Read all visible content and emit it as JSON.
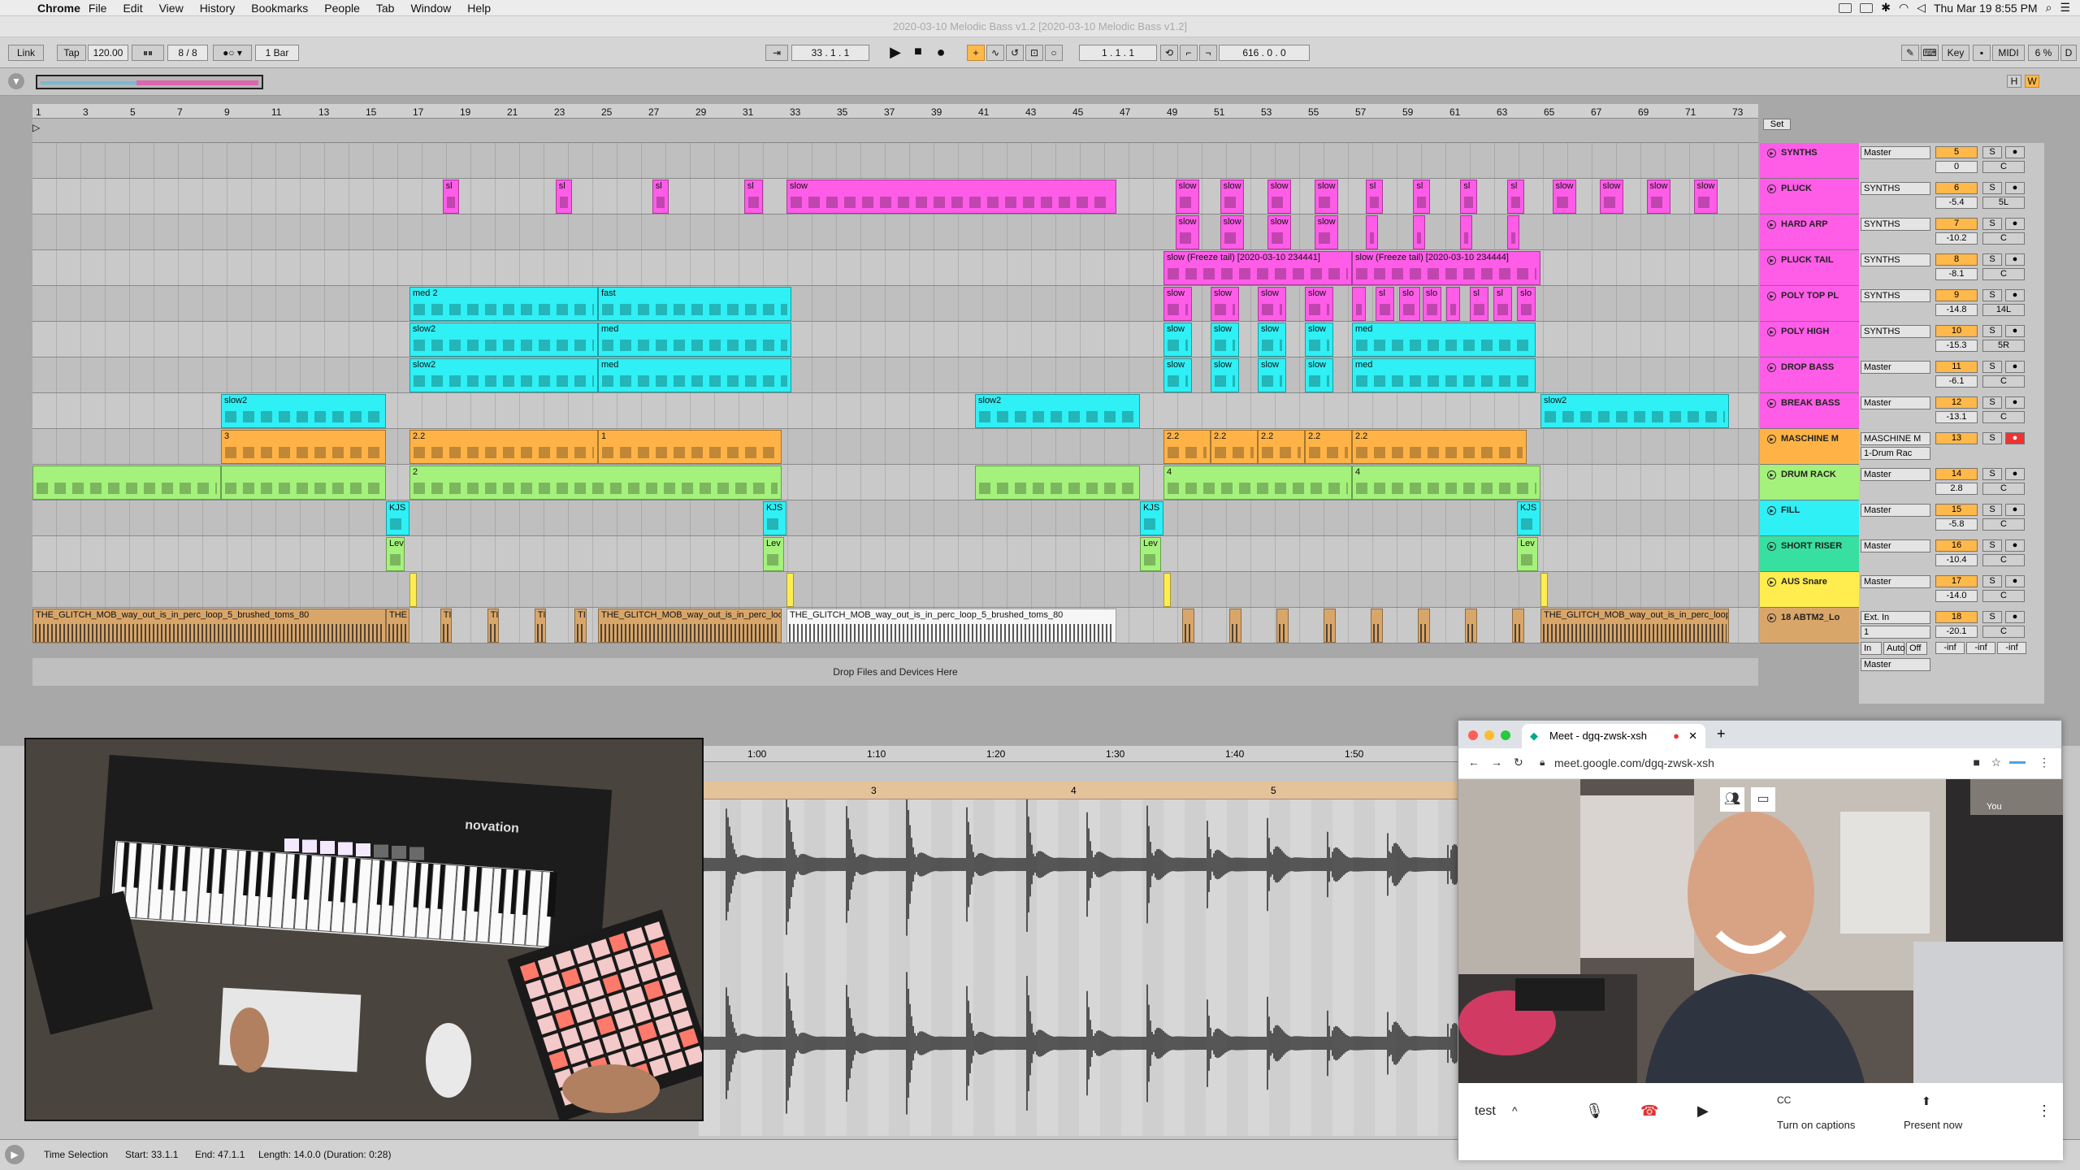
{
  "menubar": {
    "app": "Chrome",
    "items": [
      "File",
      "Edit",
      "View",
      "History",
      "Bookmarks",
      "People",
      "Tab",
      "Window",
      "Help"
    ],
    "clock": "Thu Mar 19  8:55 PM"
  },
  "window": {
    "title": "2020-03-10 Melodic Bass v1.2  [2020-03-10 Melodic Bass v1.2]"
  },
  "transport": {
    "link": "Link",
    "tap": "Tap",
    "bpm": "120.00",
    "sig": "8 / 8",
    "quant": "1 Bar",
    "position": "33 .  1 .  1",
    "loop_start": "1 .  1 .  1",
    "loop_len": "616 .  0 .  0",
    "key": "Key",
    "midi": "MIDI",
    "cpu": "6 %",
    "d": "D",
    "h": "H",
    "w": "W"
  },
  "ruler": {
    "bars": [
      "1",
      "3",
      "5",
      "7",
      "9",
      "11",
      "13",
      "15",
      "17",
      "19",
      "21",
      "23",
      "25",
      "27",
      "29",
      "31",
      "33",
      "35",
      "37",
      "39",
      "41",
      "43",
      "45",
      "47",
      "49",
      "51",
      "53",
      "55",
      "57",
      "59",
      "61",
      "63",
      "65",
      "67",
      "69",
      "71",
      "73"
    ]
  },
  "set_label": "Set",
  "drop_text": "Drop Files and Devices Here",
  "tracks": [
    {
      "name": "SYNTHS",
      "color": "#ff5ce8",
      "route": "Master",
      "num": "5",
      "vol": "0",
      "pan": "C"
    },
    {
      "name": "PLUCK",
      "color": "#ff5ce8",
      "route": "SYNTHS",
      "num": "6",
      "vol": "-5.4",
      "pan": "5L"
    },
    {
      "name": "HARD ARP",
      "color": "#ff5ce8",
      "route": "SYNTHS",
      "num": "7",
      "vol": "-10.2",
      "pan": "C"
    },
    {
      "name": "PLUCK TAIL",
      "color": "#ff5ce8",
      "route": "SYNTHS",
      "num": "8",
      "vol": "-8.1",
      "pan": "C"
    },
    {
      "name": "POLY TOP PL",
      "color": "#ff5ce8",
      "route": "SYNTHS",
      "num": "9",
      "vol": "-14.8",
      "pan": "14L"
    },
    {
      "name": "POLY HIGH",
      "color": "#ff5ce8",
      "route": "SYNTHS",
      "num": "10",
      "vol": "-15.3",
      "pan": "5R"
    },
    {
      "name": "DROP BASS",
      "color": "#ff5ce8",
      "route": "Master",
      "num": "11",
      "vol": "-6.1",
      "pan": "C"
    },
    {
      "name": "BREAK BASS",
      "color": "#ff5ce8",
      "route": "Master",
      "num": "12",
      "vol": "-13.1",
      "pan": "C"
    },
    {
      "name": "MASCHINE M",
      "color": "#ffb347",
      "route": "MASCHINE M",
      "route2": "1-Drum Rac",
      "num": "13",
      "vol": "",
      "pan": ""
    },
    {
      "name": "DRUM RACK",
      "color": "#a4f17c",
      "route": "Master",
      "num": "14",
      "vol": "2.8",
      "pan": "C"
    },
    {
      "name": "FILL",
      "color": "#2ef0f5",
      "route": "Master",
      "num": "15",
      "vol": "-5.8",
      "pan": "C"
    },
    {
      "name": "SHORT RISER",
      "color": "#37e0a0",
      "route": "Master",
      "num": "16",
      "vol": "-10.4",
      "pan": "C"
    },
    {
      "name": "AUS Snare",
      "color": "#ffed50",
      "route": "Master",
      "num": "17",
      "vol": "-14.0",
      "pan": "C"
    },
    {
      "name": "18 ABTM2_Lo",
      "color": "#d9a66a",
      "route": "Ext. In",
      "route2": "1",
      "route3": "Master",
      "num": "18",
      "vol": "-20.1",
      "pan": "C",
      "inf": [
        "-inf",
        "-inf",
        "-inf"
      ],
      "mon": [
        "In",
        "Auto",
        "Off"
      ]
    }
  ],
  "clips": {
    "pluck_s": "sl",
    "pluck_slow": "slow",
    "hardarp": "slow",
    "tail1": "slow (Freeze tail) [2020-03-10 234441]",
    "tail2": "slow (Freeze tail) [2020-03-10 234444]",
    "polytop_a": "med 2",
    "polytop_b": "fast",
    "polytop_slow": "slow",
    "polytop_sl": "sl",
    "polytop_slo": "slo",
    "polyhigh_a": "slow2",
    "polyhigh_b": "med",
    "polyhigh_slow": "slow",
    "polyhigh_med": "med",
    "drop_a": "slow2",
    "drop_b": "med",
    "drop_slow": "slow",
    "drop_med": "med",
    "break": "slow2",
    "mas_a": "3",
    "mas_b": "2.2",
    "mas_c": "1",
    "mas_d": "2.2",
    "drum_a": "2",
    "drum_b": "4",
    "drum_c": "4",
    "fill": "KJS",
    "riser": "Lev",
    "loop": "THE_GLITCH_MOB_way_out_is_in_perc_loop_5_brushed_toms_80",
    "loop_s": "THE",
    "loop_t": "TI"
  },
  "bottom": {
    "times": [
      "1:00",
      "1:10",
      "1:20",
      "1:30",
      "1:40",
      "1:50"
    ],
    "bars": [
      "3",
      "4",
      "5"
    ]
  },
  "status": {
    "label": "Time Selection",
    "start": "Start: 33.1.1",
    "end": "End: 47.1.1",
    "length": "Length: 14.0.0  (Duration: 0:28)"
  },
  "meet": {
    "tab": "Meet - dgq-zwsk-xsh",
    "url": "meet.google.com/dgq-zwsk-xsh",
    "you": "You",
    "meeting": "test",
    "captions": "Turn on captions",
    "present": "Present now"
  },
  "camera": {
    "brand": "novation"
  }
}
